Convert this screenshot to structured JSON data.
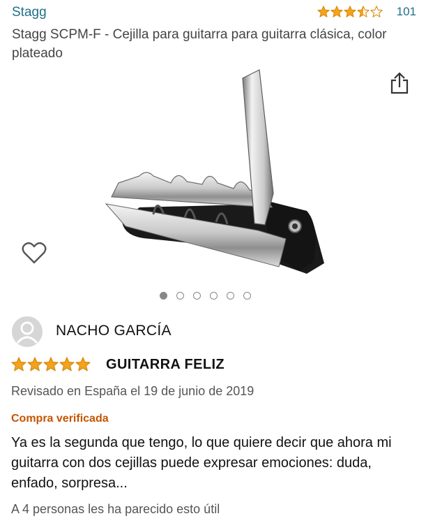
{
  "product": {
    "brand": "Stagg",
    "rating_count": "101",
    "rating": 3.5,
    "title": "Stagg SCPM-F - Cejilla para guitarra para guitarra clásica, color plateado",
    "image_pages": 6,
    "active_image_index": 0
  },
  "review": {
    "reviewer": "NACHO GARCÍA",
    "rating": 5,
    "title": "GUITARRA FELIZ",
    "date": "Revisado en España el 19 de junio de 2019",
    "verified": "Compra verificada",
    "body": "Ya es la segunda que tengo, lo que quiere decir que ahora mi guitarra con dos cejillas puede expresar emociones: duda, enfado, sorpresa...",
    "helpful": "A 4 personas les ha parecido esto útil"
  },
  "icons": {
    "share": "share-icon",
    "wishlist": "heart-icon",
    "avatar": "user-avatar-icon",
    "star": "star-icon"
  },
  "colors": {
    "link": "#1f6f8b",
    "star_fill": "#f4a41c",
    "star_stroke": "#d8890b",
    "verified": "#c45500"
  }
}
